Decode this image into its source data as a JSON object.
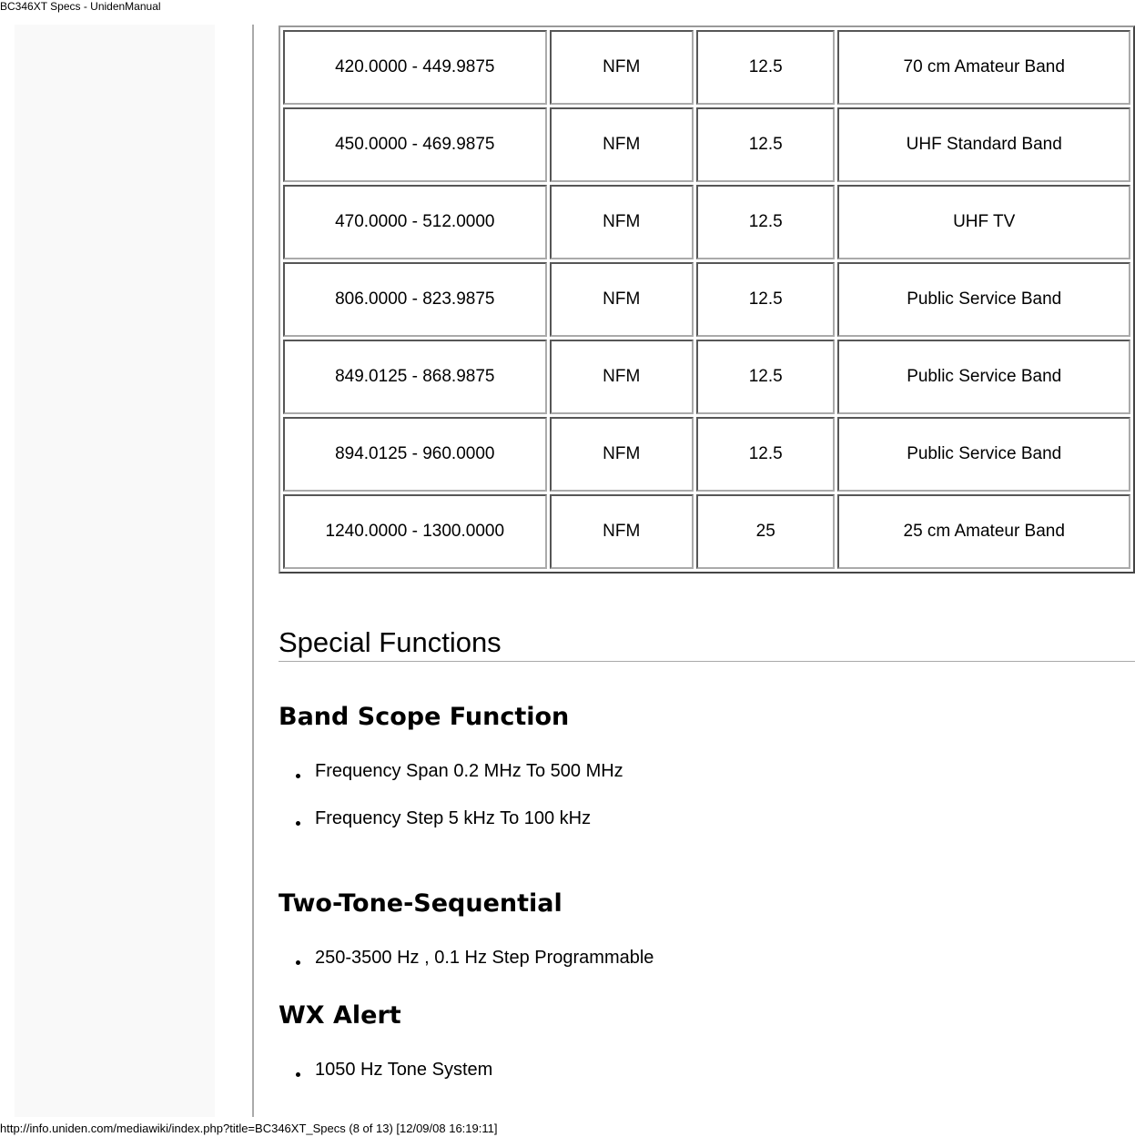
{
  "window_title": "BC346XT Specs - UnidenManual",
  "footer": "http://info.uniden.com/mediawiki/index.php?title=BC346XT_Specs (8 of 13) [12/09/08 16:19:11]",
  "table": {
    "rows": [
      [
        "420.0000 - 449.9875",
        "NFM",
        "12.5",
        "70 cm Amateur Band"
      ],
      [
        "450.0000 - 469.9875",
        "NFM",
        "12.5",
        "UHF Standard Band"
      ],
      [
        "470.0000 - 512.0000",
        "NFM",
        "12.5",
        "UHF TV"
      ],
      [
        "806.0000 - 823.9875",
        "NFM",
        "12.5",
        "Public Service Band"
      ],
      [
        "849.0125 - 868.9875",
        "NFM",
        "12.5",
        "Public Service Band"
      ],
      [
        "894.0125 - 960.0000",
        "NFM",
        "12.5",
        "Public Service Band"
      ],
      [
        "1240.0000 - 1300.0000",
        "NFM",
        "25",
        "25 cm Amateur Band"
      ]
    ]
  },
  "special": {
    "title": "Special Functions",
    "band_scope": {
      "title": "Band Scope Function",
      "items": [
        "Frequency Span 0.2 MHz To 500 MHz",
        "Frequency Step 5 kHz To 100 kHz"
      ]
    },
    "two_tone": {
      "title": "Two-Tone-Sequential",
      "items": [
        "250-3500 Hz , 0.1 Hz Step Programmable"
      ]
    },
    "wx": {
      "title": "WX Alert",
      "items": [
        "1050 Hz Tone System"
      ]
    }
  }
}
